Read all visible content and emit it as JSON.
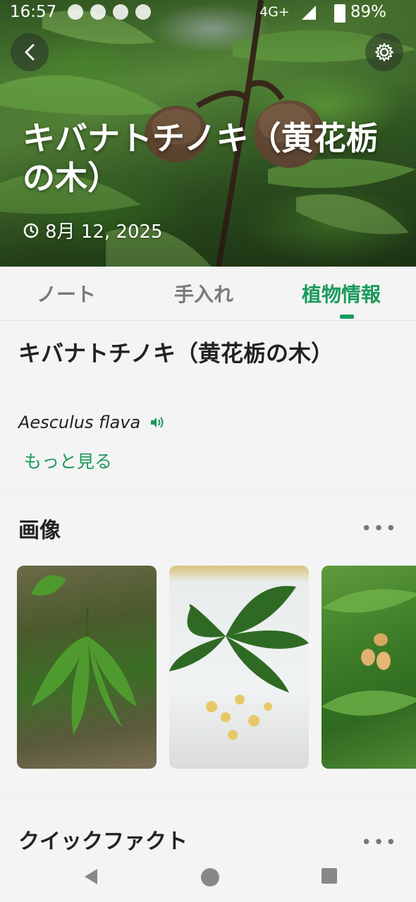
{
  "status_bar": {
    "time": "16:57",
    "network": "4G+",
    "battery": "89%"
  },
  "header": {
    "back_icon": "chevron-left-icon",
    "settings_icon": "gear-icon",
    "title": "キバナトチノキ（黄花栃の木）",
    "date": "8月 12, 2025"
  },
  "tabs": [
    {
      "label": "ノート",
      "active": false
    },
    {
      "label": "手入れ",
      "active": false
    },
    {
      "label": "植物情報",
      "active": true
    }
  ],
  "plant_info": {
    "common_name": "キバナトチノキ（黄花栃の木）",
    "scientific_name": "Aesculus flava",
    "more_label": "もっと見る"
  },
  "images_section": {
    "title": "画像",
    "more_icon": "more-horizontal-icon"
  },
  "quick_facts": {
    "title": "クイックファクト"
  },
  "colors": {
    "accent": "#1a9a5c",
    "text": "#222222",
    "background": "#f4f4f4"
  }
}
